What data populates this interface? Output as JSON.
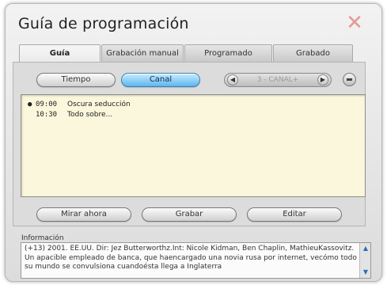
{
  "window": {
    "title": "Guía de programación",
    "close_glyph": "✕"
  },
  "tabs": [
    {
      "label": "Guía"
    },
    {
      "label": "Grabación manual"
    },
    {
      "label": "Programado"
    },
    {
      "label": "Grabado"
    }
  ],
  "view_toggle": {
    "tiempo": "Tiempo",
    "canal": "Canal"
  },
  "channel_nav": {
    "prev": "◀",
    "label": "3 - CANAL+",
    "next": "▶"
  },
  "programs": [
    {
      "bullet": "●",
      "time": "09:00",
      "title": "Oscura seducción"
    },
    {
      "bullet": "",
      "time": "10:30",
      "title": "Todo sobre..."
    }
  ],
  "actions": {
    "mirar": "Mirar ahora",
    "grabar": "Grabar",
    "editar": "Editar"
  },
  "info": {
    "label": "Información",
    "text": "(+13) 2001. EE.UU. Dir: Jez Butterworthz.Int: Nicole Kidman, Ben Chaplin, MathieuKassovitz. Un apacible empleado de banca, que haencargado una novia rusa por internet, vecómo todo su mundo se convulsiona cuandoésta llega a Inglaterra"
  },
  "colors": {
    "list_bg": "#faf7dc",
    "active_pill": "#5eb6ee",
    "close": "#e29a93"
  }
}
